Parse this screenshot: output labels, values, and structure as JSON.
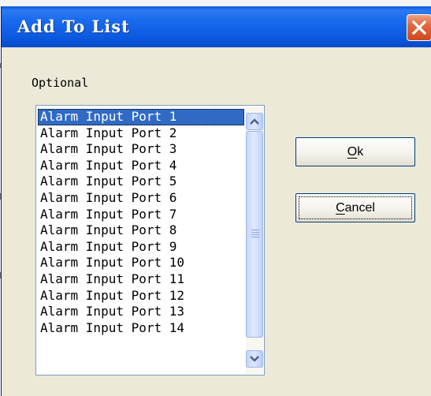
{
  "dialog": {
    "title": "Add To List",
    "optional_label": "Optional",
    "list_items": [
      "Alarm Input Port 1",
      "Alarm Input Port 2",
      "Alarm Input Port 3",
      "Alarm Input Port 4",
      "Alarm Input Port 5",
      "Alarm Input Port 6",
      "Alarm Input Port 7",
      "Alarm Input Port 8",
      "Alarm Input Port 9",
      "Alarm Input Port 10",
      "Alarm Input Port 11",
      "Alarm Input Port 12",
      "Alarm Input Port 13",
      "Alarm Input Port 14"
    ],
    "selected_index": 0,
    "ok_accel": "O",
    "ok_rest": "k",
    "cancel_accel": "C",
    "cancel_rest": "ancel"
  },
  "icons": {
    "close": "close-icon",
    "scroll_up": "chevron-up-icon",
    "scroll_down": "chevron-down-icon",
    "scroll_grip": "grip-icon"
  },
  "colors": {
    "titlebar": "#0b5ae0",
    "selection": "#316ac5",
    "close_button": "#d0491b",
    "dialog_face": "#ece9d8"
  }
}
